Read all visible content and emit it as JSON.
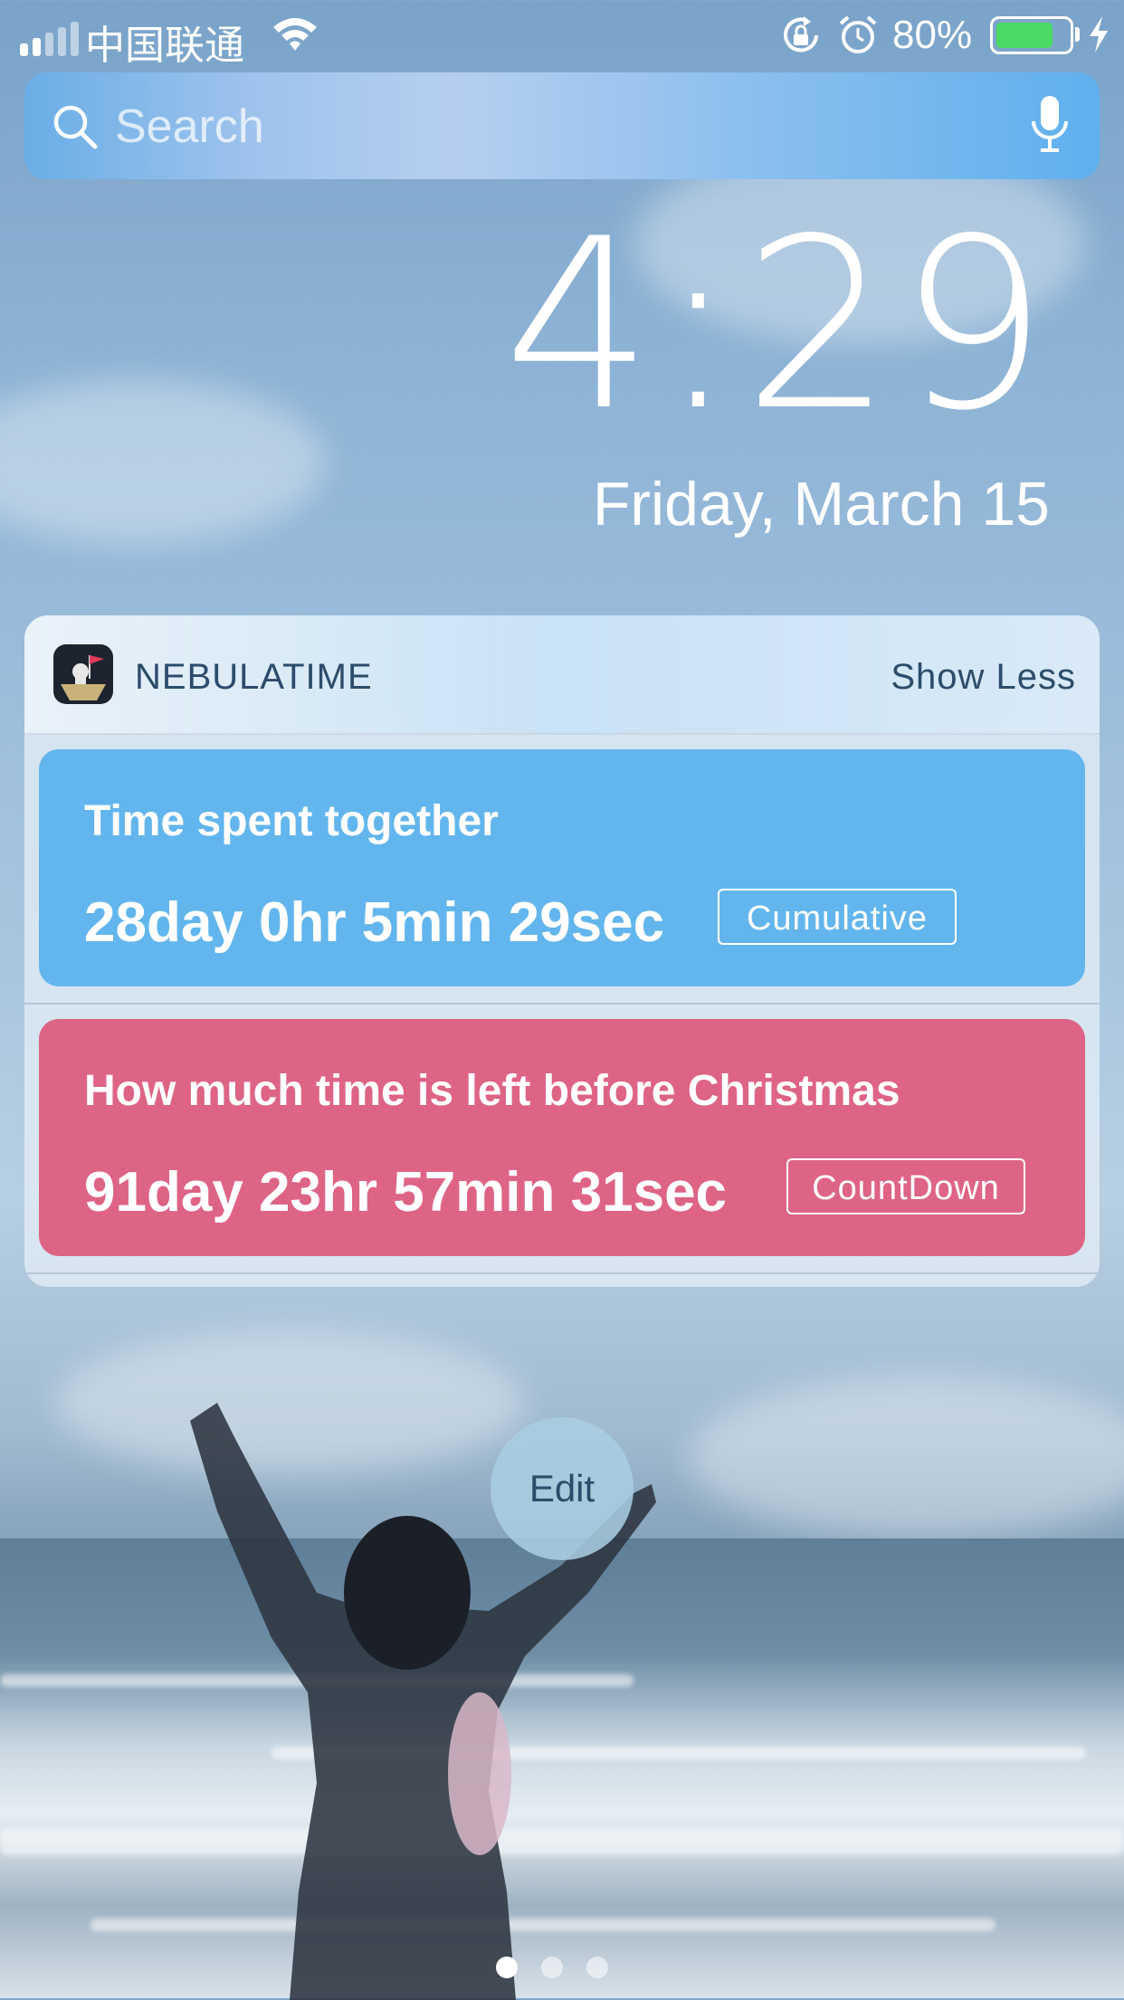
{
  "status_bar": {
    "carrier": "中国联通",
    "battery_percent": "80%",
    "battery_level": 0.8,
    "signal_bars": 2,
    "icons": [
      "signal-icon",
      "wifi-icon",
      "rotation-lock-icon",
      "alarm-icon",
      "battery-icon",
      "charging-bolt-icon"
    ]
  },
  "search": {
    "placeholder": "Search",
    "icons": [
      "search-icon",
      "microphone-icon"
    ]
  },
  "clock": {
    "time": "4:29",
    "date": "Friday, March 15"
  },
  "widget": {
    "app_name": "NEBULATIME",
    "show_less_label": "Show Less",
    "cards": [
      {
        "title": "Time spent together",
        "value": "28day 0hr 5min 29sec",
        "badge": "Cumulative",
        "color": "#63b6ed"
      },
      {
        "title": "How much time is left before Christmas",
        "value": "91day 23hr 57min 31sec",
        "badge": "CountDown",
        "color": "#de6486"
      }
    ]
  },
  "edit_label": "Edit",
  "page_dots": {
    "count": 3,
    "active_index": 0
  }
}
